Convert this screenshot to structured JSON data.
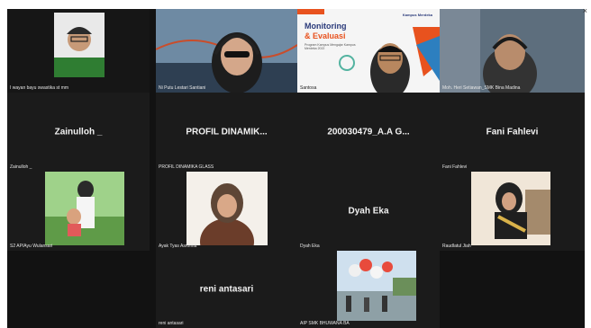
{
  "window": {
    "close_glyph": "×"
  },
  "tiles": [
    {
      "display_name": "I wayan bayu swastika st mm",
      "big_label": ""
    },
    {
      "display_name": "Ni Putu Lestari Santiani",
      "big_label": ""
    },
    {
      "display_name": "Santosa",
      "big_label": ""
    },
    {
      "display_name": "Moh. Heri Setiawan_SMK Bina Madina",
      "big_label": ""
    },
    {
      "display_name": "Zainulloh _",
      "big_label": "Zainulloh _"
    },
    {
      "display_name": "PROFIL DINAMIKA GLASS",
      "big_label": "PROFIL  DINAMIK..."
    },
    {
      "display_name": "",
      "big_label": "200030479_A.A G..."
    },
    {
      "display_name": "Fani Fahlevi",
      "big_label": "Fani Fahlevi"
    },
    {
      "display_name": "S2 AP/Ayu Wulansari",
      "big_label": ""
    },
    {
      "display_name": "Ayak Tyas Asrofina",
      "big_label": ""
    },
    {
      "display_name": "Dyah Eka",
      "big_label": "Dyah Eka"
    },
    {
      "display_name": "Raudlatul Jiah",
      "big_label": ""
    },
    {
      "display_name": "reni antasari",
      "big_label": "reni antasari"
    },
    {
      "display_name": "AIP SMK BHUWANA BA",
      "big_label": ""
    }
  ],
  "shared_slide": {
    "title_line1": "Monitoring",
    "title_line2": "& Evaluasi",
    "subtitle": "Program Kampus Mengajar Kampus Merdeka 2022",
    "badge": "Kampus Merdeka",
    "tag": "Kampus"
  },
  "colors": {
    "background": "#121212",
    "tile": "#1b1b1b",
    "accent": "#e8521e"
  }
}
